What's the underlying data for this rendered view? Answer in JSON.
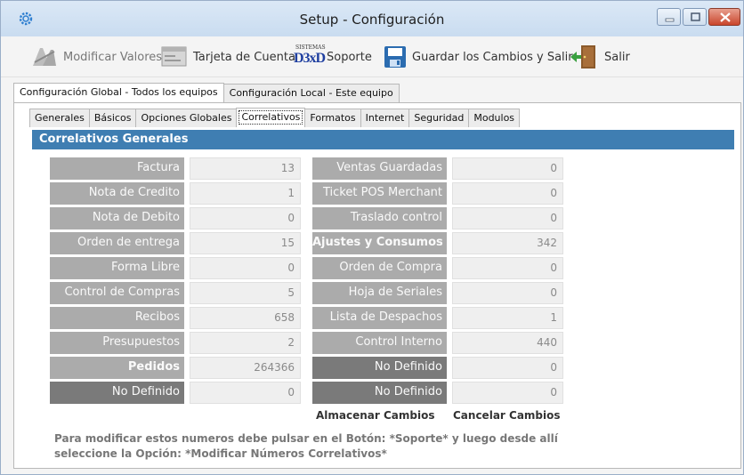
{
  "window": {
    "title": "Setup - Configuración",
    "icon": "gear-icon"
  },
  "toolbar": {
    "modificar_label": "Modificar Valores",
    "tarjeta_label": "Tarjeta de Cuenta",
    "soporte_logo_top": "SISTEMAS",
    "soporte_logo": "D3xD",
    "soporte_label": "Soporte",
    "guardar_label": "Guardar los Cambios  y Salir",
    "salir_label": "Salir"
  },
  "outer_tabs": [
    {
      "label": "Configuración Global - Todos los equipos",
      "active": true
    },
    {
      "label": "Configuración Local - Este equipo",
      "active": false
    }
  ],
  "inner_tabs": [
    {
      "label": "Generales"
    },
    {
      "label": "Básicos"
    },
    {
      "label": "Opciones Globales"
    },
    {
      "label": "Correlativos",
      "active": true
    },
    {
      "label": "Formatos"
    },
    {
      "label": "Internet"
    },
    {
      "label": "Seguridad"
    },
    {
      "label": "Modulos"
    }
  ],
  "section": {
    "title": "Correlativos Generales"
  },
  "left_rows": [
    {
      "label": "Factura",
      "value": "13"
    },
    {
      "label": "Nota de Credito",
      "value": "1"
    },
    {
      "label": "Nota de Debito",
      "value": "0"
    },
    {
      "label": "Orden de entrega",
      "value": "15"
    },
    {
      "label": "Forma Libre",
      "value": "0"
    },
    {
      "label": "Control de Compras",
      "value": "5"
    },
    {
      "label": "Recibos",
      "value": "658"
    },
    {
      "label": "Presupuestos",
      "value": "2"
    },
    {
      "label": "Pedidos",
      "value": "264366"
    },
    {
      "label": "No Definido",
      "value": "0"
    }
  ],
  "right_rows": [
    {
      "label": "Ventas Guardadas",
      "value": "0"
    },
    {
      "label": "Ticket POS Merchant",
      "value": "0"
    },
    {
      "label": "Traslado control",
      "value": "0"
    },
    {
      "label": "Ajustes y Consumos",
      "value": "342"
    },
    {
      "label": "Orden de Compra",
      "value": "0"
    },
    {
      "label": "Hoja de Seriales",
      "value": "0"
    },
    {
      "label": "Lista de Despachos",
      "value": "1"
    },
    {
      "label": "Control Interno",
      "value": "440"
    },
    {
      "label": "No Definido",
      "value": "0"
    },
    {
      "label": "No Definido",
      "value": "0"
    }
  ],
  "actions": {
    "save": "Almacenar Cambios",
    "cancel": "Cancelar Cambios"
  },
  "note": {
    "line1": "Para modificar estos numeros debe pulsar en el Botón: *Soporte* y luego desde allí",
    "line2": "seleccione la Opción: *Modificar Números Correlativos*"
  },
  "colors": {
    "section_header": "#3f7eb2",
    "label_bg": "#ababab",
    "label_dark_bg": "#7a7a7a",
    "value_bg": "#efefef"
  }
}
